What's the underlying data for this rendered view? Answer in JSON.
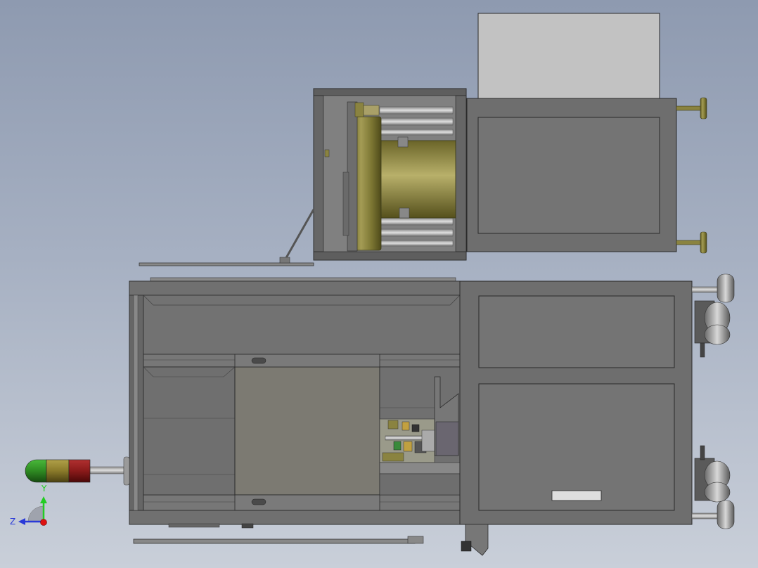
{
  "view": {
    "background_top": "#8e9ab0",
    "background_bottom": "#c9cfd9"
  },
  "model": {
    "body_color": "#6e6e6e",
    "panel_color": "#747474",
    "frame_color": "#5a5a5a",
    "edge_color": "#2a2a2a",
    "brass_color": "#8a8340",
    "cover_color": "#c2c2c2"
  },
  "signal_tower": {
    "segments": [
      {
        "color": "#2e8a22"
      },
      {
        "color": "#8a7a2a"
      },
      {
        "color": "#8a1a1a"
      }
    ]
  },
  "triad": {
    "y_label": "Y",
    "z_label": "Z",
    "y_color": "#22cc22",
    "z_color": "#2a3ad8",
    "x_color": "#dd1111"
  }
}
